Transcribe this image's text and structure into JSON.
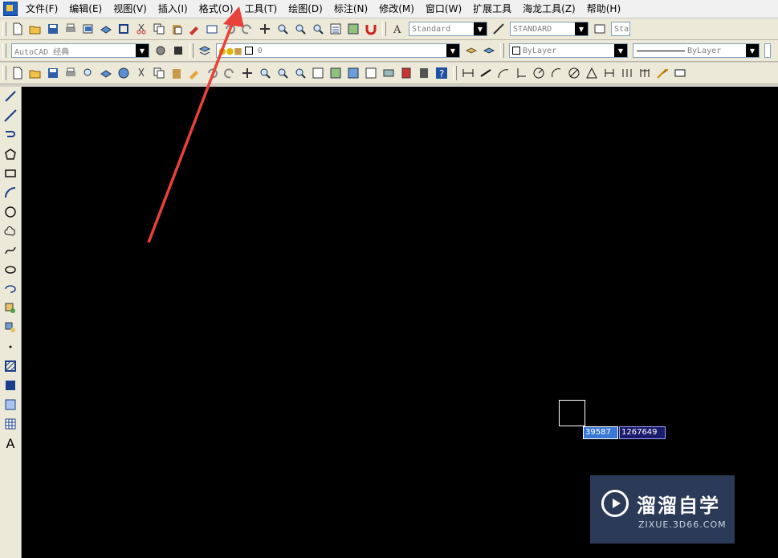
{
  "menu": {
    "items": [
      "文件(F)",
      "编辑(E)",
      "视图(V)",
      "插入(I)",
      "格式(O)",
      "工具(T)",
      "绘图(D)",
      "标注(N)",
      "修改(M)",
      "窗口(W)",
      "扩展工具",
      "海龙工具(Z)",
      "帮助(H)"
    ]
  },
  "toolbar1": {
    "text_style": "Standard",
    "dim_style": "STANDARD",
    "table_style": "Sta"
  },
  "toolbar2": {
    "workspace": "AutoCAD 经典",
    "layer": "0",
    "color": "ByLayer",
    "linetype": "ByLayer"
  },
  "canvas": {
    "coord_x": "39587",
    "coord_y": "1267649"
  },
  "watermark": {
    "title": "溜溜自学",
    "subtitle": "ZIXUE.3D66.COM"
  },
  "colors": {
    "canvas_bg": "#000000",
    "annotation_arrow": "#e8413a"
  },
  "left_tools": [
    "line-icon",
    "construction-line-icon",
    "polyline-icon",
    "polygon-icon",
    "rectangle-icon",
    "arc-icon",
    "circle-icon",
    "revision-cloud-icon",
    "spline-icon",
    "ellipse-icon",
    "ellipse-arc-icon",
    "insert-block-icon",
    "make-block-icon",
    "point-icon",
    "hatch-icon",
    "gradient-icon",
    "region-icon",
    "table-icon",
    "multiline-text-icon"
  ]
}
